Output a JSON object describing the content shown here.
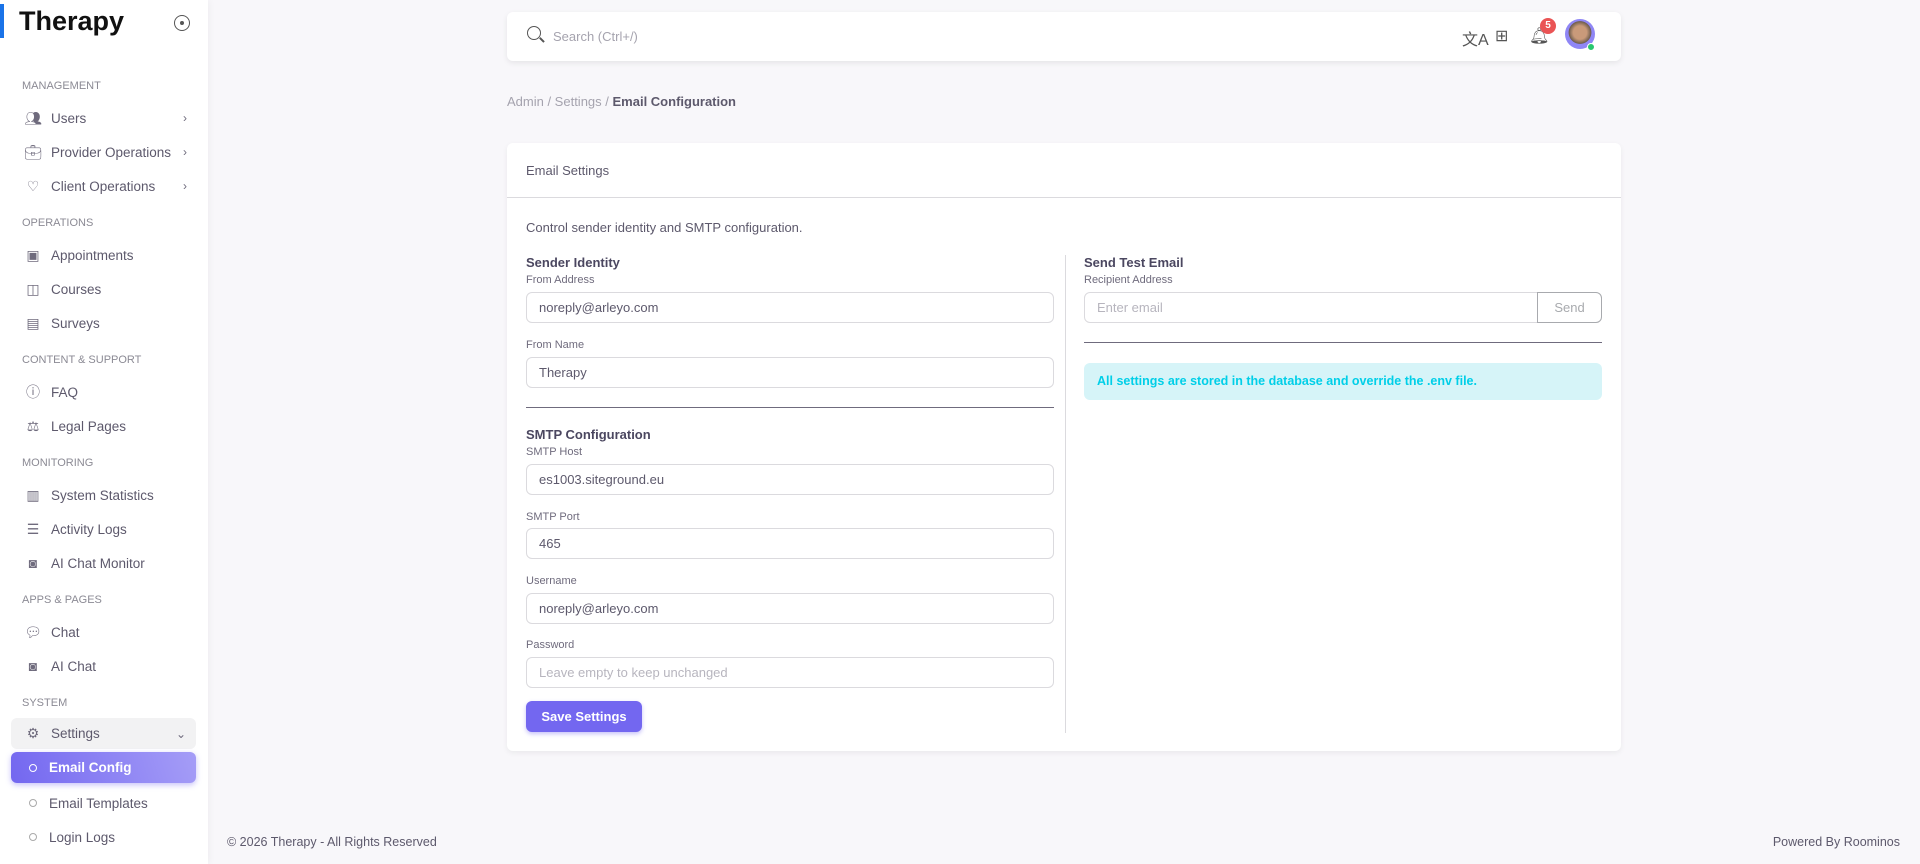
{
  "brand": "Therapy",
  "sidebar": {
    "sections": [
      {
        "label": "MANAGEMENT",
        "items": [
          {
            "label": "Users"
          },
          {
            "label": "Provider Operations"
          },
          {
            "label": "Client Operations"
          }
        ]
      },
      {
        "label": "OPERATIONS",
        "items": [
          {
            "label": "Appointments"
          },
          {
            "label": "Courses"
          },
          {
            "label": "Surveys"
          }
        ]
      },
      {
        "label": "CONTENT & SUPPORT",
        "items": [
          {
            "label": "FAQ"
          },
          {
            "label": "Legal Pages"
          }
        ]
      },
      {
        "label": "MONITORING",
        "items": [
          {
            "label": "System Statistics"
          },
          {
            "label": "Activity Logs"
          },
          {
            "label": "AI Chat Monitor"
          }
        ]
      },
      {
        "label": "APPS & PAGES",
        "items": [
          {
            "label": "Chat"
          },
          {
            "label": "AI Chat"
          }
        ]
      },
      {
        "label": "SYSTEM",
        "items": [
          {
            "label": "Settings"
          },
          {
            "label": "Email Config"
          },
          {
            "label": "Email Templates"
          },
          {
            "label": "Login Logs"
          }
        ]
      }
    ]
  },
  "topbar": {
    "search_placeholder": "Search (Ctrl+/)",
    "notification_count": "5"
  },
  "breadcrumb": {
    "path": "Admin / Settings / ",
    "current": "Email Configuration"
  },
  "card": {
    "title": "Email Settings",
    "description": "Control sender identity and SMTP configuration.",
    "sender": {
      "heading": "Sender Identity",
      "from_address_label": "From Address",
      "from_address": "noreply@arleyo.com",
      "from_name_label": "From Name",
      "from_name": "Therapy"
    },
    "smtp": {
      "heading": "SMTP Configuration",
      "host_label": "SMTP Host",
      "host": "es1003.siteground.eu",
      "port_label": "SMTP Port",
      "port": "465",
      "username_label": "Username",
      "username": "noreply@arleyo.com",
      "password_label": "Password",
      "password_placeholder": "Leave empty to keep unchanged"
    },
    "save_label": "Save Settings",
    "test": {
      "heading": "Send Test Email",
      "recipient_label": "Recipient Address",
      "recipient_placeholder": "Enter email",
      "send_label": "Send"
    },
    "alert": "All settings are stored in the database and override the .env file."
  },
  "footer": {
    "copyright": "© 2026 Therapy - All Rights Reserved",
    "powered": "Powered By Roominos"
  },
  "colors": {
    "primary": "#7367f0",
    "info": "#00cfe8",
    "danger": "#ea5455",
    "success": "#28c76f"
  }
}
